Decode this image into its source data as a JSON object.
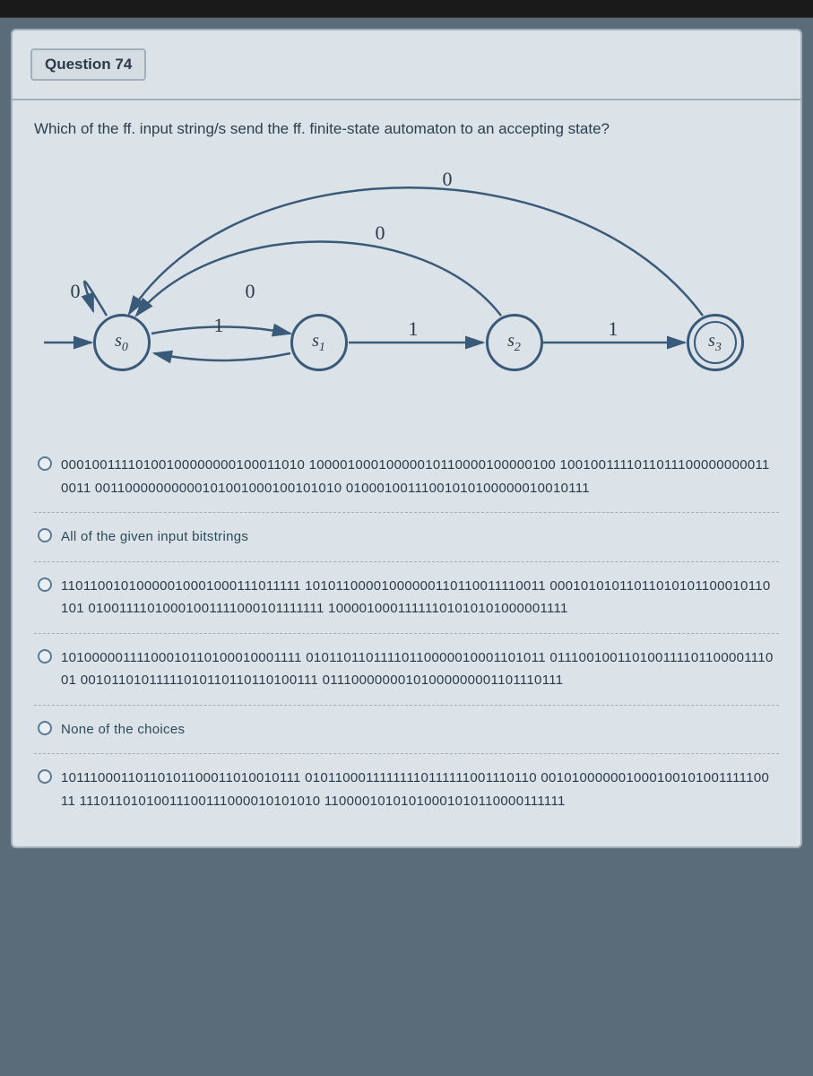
{
  "browser_title": "",
  "question": {
    "label": "Question 74",
    "prompt": "Which of the ff. input string/s send the ff. finite-state automaton to an accepting state?"
  },
  "automaton": {
    "states": [
      "s0",
      "s1",
      "s2",
      "s3"
    ],
    "labels": {
      "self_loop_s0": "0",
      "s0_s1": "1",
      "s1_s0": "0",
      "s1_s2": "1",
      "s2_s0": "0",
      "s2_s3": "1",
      "s3_s0": "0"
    }
  },
  "options": [
    {
      "text": "00010011110100100000000100011010 10000100010000010110000100000100 10010011110110111000000000110011 00110000000000101001000100101010 01000100111001010100000010010111"
    },
    {
      "text": "All of the given input bitstrings"
    },
    {
      "text": "11011001010000010001000111011111 10101100001000000110110011110011 00010101011011010101100010110101 01001111010001001111000101111111 10000100011111101010101000001111"
    },
    {
      "text": "10100000111100010110100010001111 01011011011110110000010001101011 01110010011010011110110000111001 00101101011111010110110110100111 01110000000101000000001101110111"
    },
    {
      "text": "None of the choices"
    },
    {
      "text": "10111000110110101100011010010111 01011000111111110111111001110110 00101000000100010010100111110011 11101101010011100111000010101010 11000010101010001010110000111111"
    }
  ]
}
